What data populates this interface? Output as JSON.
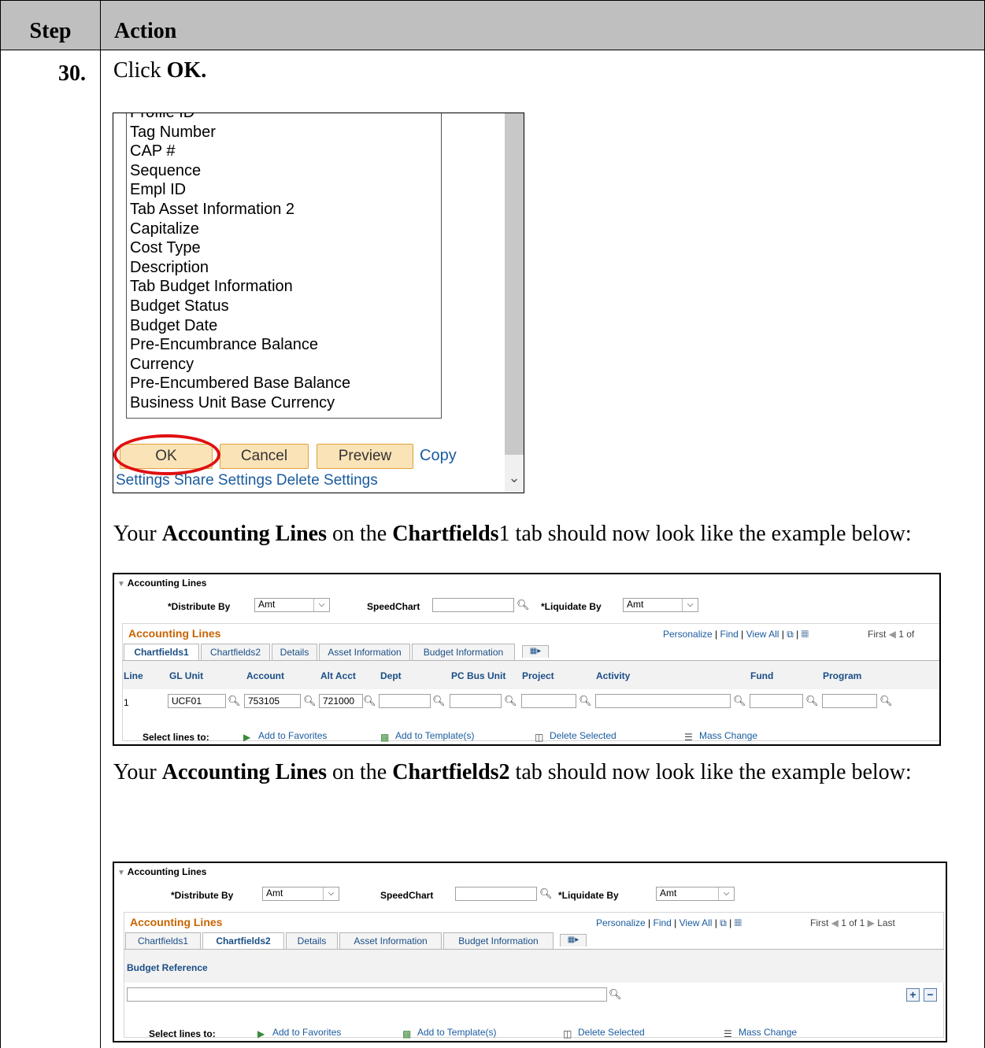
{
  "table": {
    "col_step": "Step",
    "col_action": "Action",
    "step_number": "30."
  },
  "instruction": {
    "prefix": "Click ",
    "bold": "OK."
  },
  "column_selector": {
    "items": [
      "Profile ID",
      "Tag Number",
      "CAP #",
      "Sequence",
      "Empl ID",
      "Tab Asset Information 2",
      "Capitalize",
      "Cost Type",
      "Description",
      "Tab Budget Information",
      "Budget Status",
      "Budget Date",
      "Pre-Encumbrance Balance",
      "Currency",
      "Pre-Encumbered Base Balance",
      "Business Unit Base Currency"
    ],
    "ok_label": "OK",
    "cancel_label": "Cancel",
    "preview_label": "Preview",
    "copy_label": "Copy",
    "settings_label": "Settings",
    "share_label": "Share Settings",
    "delete_label": "Delete Settings",
    "highlight_color": "#e01010"
  },
  "para1": {
    "t1": "Your ",
    "b1": "Accounting Lines",
    "t2": " on the ",
    "b2": "Chartfields",
    "t3": "1 tab should now look like the example below:"
  },
  "para2": {
    "t1": "Your ",
    "b1": "Accounting Lines",
    "t2": " on the ",
    "b2": "Chartfields2",
    "t3": " tab should now look like the example below:"
  },
  "acct1": {
    "section_title": "Accounting Lines",
    "distribute_label": "*Distribute By",
    "distribute_value": "Amt",
    "speedchart_label": "SpeedChart",
    "liquidate_label": "*Liquidate By",
    "liquidate_value": "Amt",
    "grid_title": "Accounting Lines",
    "personalize": "Personalize",
    "find": "Find",
    "view_all": "View All",
    "first": "First",
    "page_info": "1 of",
    "tabs": [
      "Chartfields1",
      "Chartfields2",
      "Details",
      "Asset Information",
      "Budget Information"
    ],
    "columns": [
      "Line",
      "GL Unit",
      "Account",
      "Alt Acct",
      "Dept",
      "PC Bus Unit",
      "Project",
      "Activity",
      "Fund",
      "Program"
    ],
    "row": {
      "line": "1",
      "gl_unit": "UCF01",
      "account": "753105",
      "alt_acct": "721000"
    },
    "select_lines_label": "Select lines to:",
    "add_favorites": "Add to Favorites",
    "add_template": "Add to Template(s)",
    "delete_selected": "Delete Selected",
    "mass_change": "Mass Change"
  },
  "acct2": {
    "section_title": "Accounting Lines",
    "distribute_label": "*Distribute By",
    "distribute_value": "Amt",
    "speedchart_label": "SpeedChart",
    "liquidate_label": "*Liquidate By",
    "liquidate_value": "Amt",
    "grid_title": "Accounting Lines",
    "personalize": "Personalize",
    "find": "Find",
    "view_all": "View All",
    "first": "First",
    "page_info": "1 of 1",
    "last": "Last",
    "tabs": [
      "Chartfields1",
      "Chartfields2",
      "Details",
      "Asset Information",
      "Budget Information"
    ],
    "budget_reference_label": "Budget Reference",
    "select_lines_label": "Select lines to:",
    "add_favorites": "Add to Favorites",
    "add_template": "Add to Template(s)",
    "delete_selected": "Delete Selected",
    "mass_change": "Mass Change"
  }
}
